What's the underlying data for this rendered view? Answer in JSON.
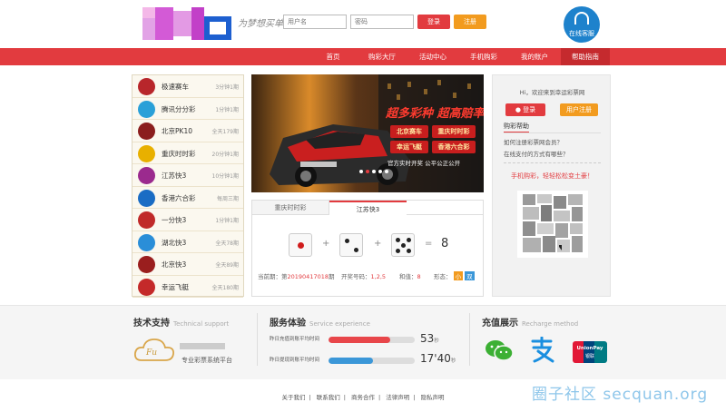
{
  "header": {
    "slogan": "为梦想买单",
    "username_placeholder": "用户名",
    "password_placeholder": "密码",
    "login_label": "登录",
    "register_label": "注册",
    "online_service_label": "在线客服"
  },
  "nav": {
    "items": [
      "首页",
      "购彩大厅",
      "活动中心",
      "手机购彩",
      "我的账户",
      "帮助指南"
    ],
    "active": "帮助指南"
  },
  "lottery_list": [
    {
      "name": "极速赛车",
      "freq": "3分钟1期",
      "icon_color": "#b8262b"
    },
    {
      "name": "腾讯分分彩",
      "freq": "1分钟1期",
      "icon_color": "#2aa0d8"
    },
    {
      "name": "北京PK10",
      "freq": "全天179期",
      "icon_color": "#8b1e1e"
    },
    {
      "name": "重庆时时彩",
      "freq": "20分钟1期",
      "icon_color": "#e8b000"
    },
    {
      "name": "江苏快3",
      "freq": "10分钟1期",
      "icon_color": "#9b2a8e"
    },
    {
      "name": "香港六合彩",
      "freq": "每周三期",
      "icon_color": "#1a6cc4"
    },
    {
      "name": "一分快3",
      "freq": "1分钟1期",
      "icon_color": "#c02a2a"
    },
    {
      "name": "湖北快3",
      "freq": "全天78期",
      "icon_color": "#2a8ed8"
    },
    {
      "name": "北京快3",
      "freq": "全天89期",
      "icon_color": "#9a1e1e"
    },
    {
      "name": "幸运飞艇",
      "freq": "全天180期",
      "icon_color": "#c42a2a"
    }
  ],
  "banner": {
    "headline": "超多彩种 超高赔率",
    "tags": [
      "北京赛车",
      "重庆时时彩",
      "幸运飞艇",
      "香港六合彩"
    ],
    "caption": "官方实时开奖 公平公正公开"
  },
  "dice": {
    "tabs": [
      "重庆时时彩",
      "江苏快3"
    ],
    "active_tab": "江苏快3",
    "values": [
      1,
      2,
      5
    ],
    "sum": "8",
    "current_issue_label": "当前期：第",
    "current_issue": "20190417018",
    "issue_suffix": "期",
    "draw_label": "开奖号码：",
    "draw_numbers": "1,2,5",
    "sum_label": "和值：",
    "sum_value": "8",
    "pattern_label": "形态：",
    "pattern_a": "小",
    "pattern_b": "双"
  },
  "account_box": {
    "welcome": "Hi，欢迎来到幸运彩票网",
    "login_label": "登录",
    "register_label": "用户注册",
    "help_title": "购彩帮助",
    "help_links": [
      "如何注册彩票网会员？",
      "在线支付的方式有哪些？"
    ],
    "mobile_promo": "手机购彩，轻轻松松变土豪！"
  },
  "footer": {
    "tech": {
      "title": "技术支持",
      "subtitle": "Technical support",
      "caption": "专业彩票系统平台"
    },
    "service": {
      "title": "服务体验",
      "subtitle": "Service experience",
      "rows": [
        {
          "label": "昨日充值到账平均时间",
          "value": "53",
          "unit": "秒",
          "fraction": 0.72,
          "color": "#e8464a"
        },
        {
          "label": "昨日提现到账平均时间",
          "value": "17'40",
          "unit": "秒",
          "fraction": 0.52,
          "color": "#3b97d8"
        }
      ]
    },
    "recharge": {
      "title": "充值展示",
      "subtitle": "Recharge method",
      "unionpay_label": "UnionPay",
      "unionpay_cn": "银联"
    },
    "links": [
      "关于我们",
      "联系我们",
      "商务合作",
      "法律声明",
      "隐私声明"
    ]
  },
  "watermark": "圈子社区 secquan.org"
}
